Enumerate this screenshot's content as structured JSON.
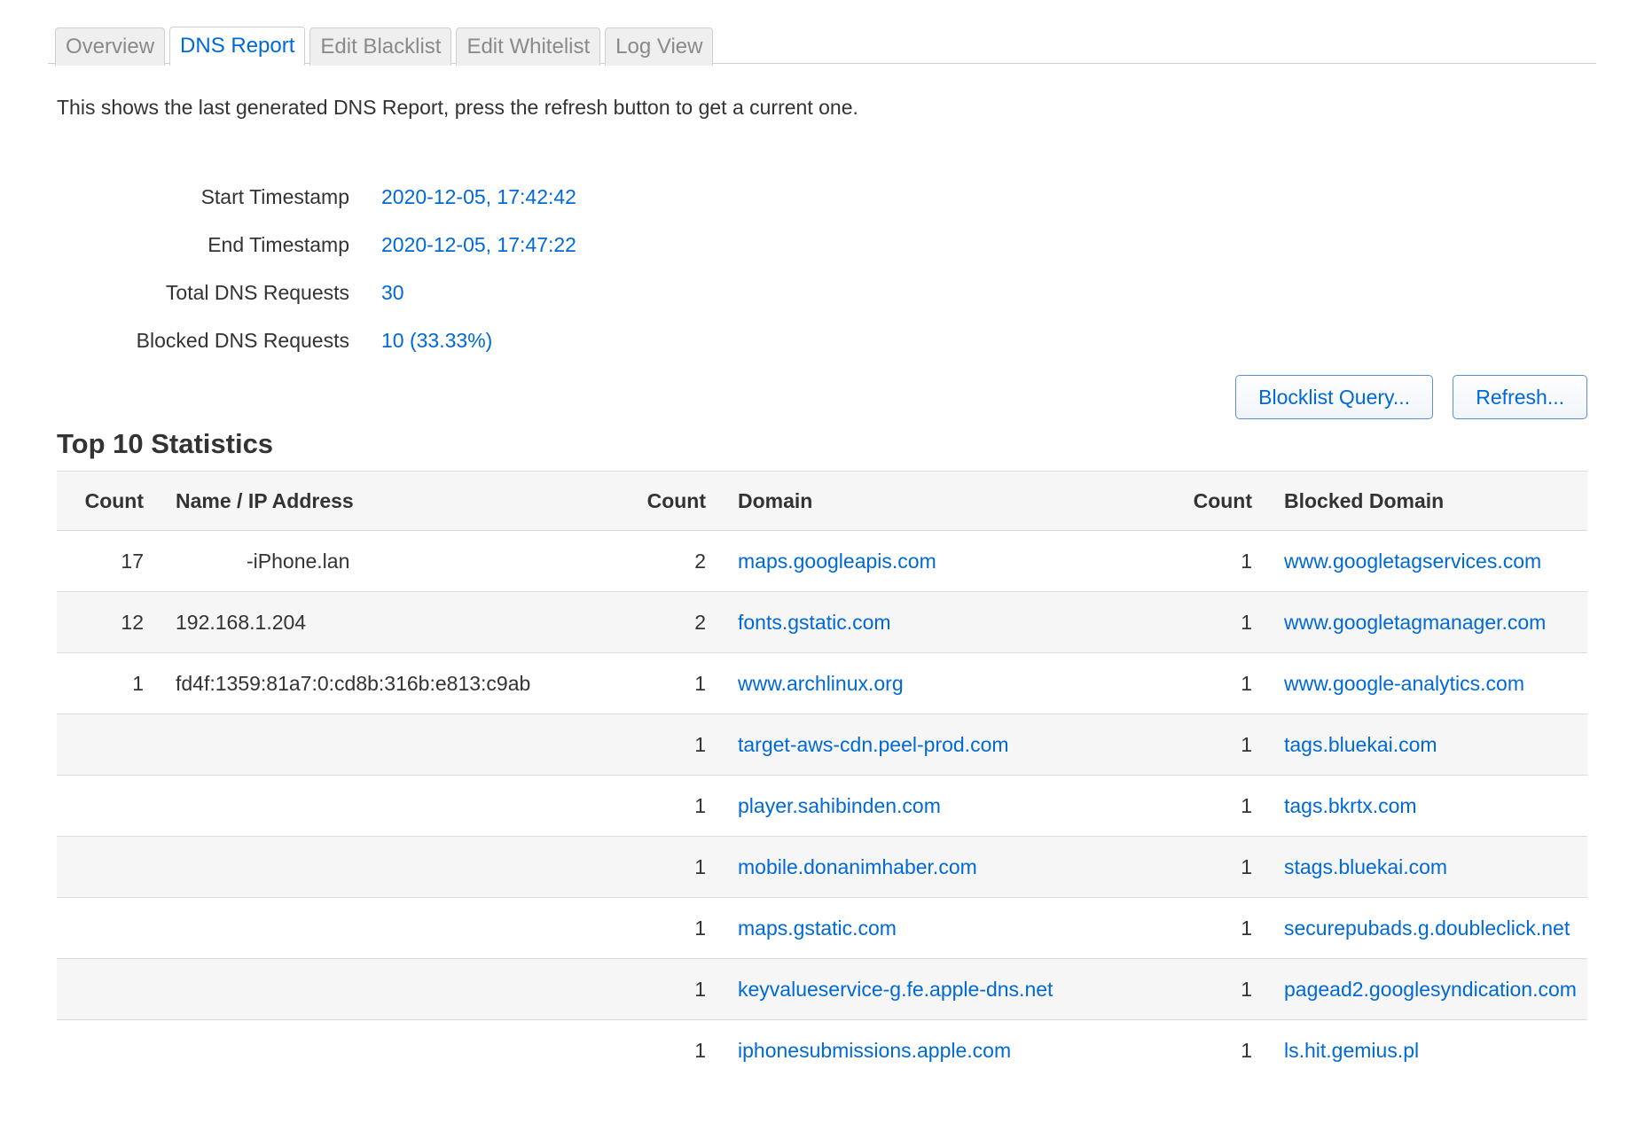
{
  "tabs": [
    {
      "label": "Overview",
      "active": false
    },
    {
      "label": "DNS Report",
      "active": true
    },
    {
      "label": "Edit Blacklist",
      "active": false
    },
    {
      "label": "Edit Whitelist",
      "active": false
    },
    {
      "label": "Log View",
      "active": false
    }
  ],
  "intro": "This shows the last generated DNS Report, press the refresh button to get a current one.",
  "summary": {
    "start_label": "Start Timestamp",
    "start_value": "2020-12-05, 17:42:42",
    "end_label": "End Timestamp",
    "end_value": "2020-12-05, 17:47:22",
    "total_label": "Total DNS Requests",
    "total_value": "30",
    "blocked_label": "Blocked DNS Requests",
    "blocked_value": "10 (33.33%)"
  },
  "buttons": {
    "query": "Blocklist Query...",
    "refresh": "Refresh..."
  },
  "colors": {
    "accent": "#0069d6",
    "text": "#333333",
    "row_alt": "#f6f6f6"
  },
  "stats": {
    "title": "Top 10 Statistics",
    "headers": [
      "Count",
      "Name / IP Address",
      "Count",
      "Domain",
      "Count",
      "Blocked Domain"
    ],
    "rows": [
      [
        "17",
        "-iPhone.lan",
        "2",
        "maps.googleapis.com",
        "1",
        "www.googletagservices.com"
      ],
      [
        "12",
        "192.168.1.204",
        "2",
        "fonts.gstatic.com",
        "1",
        "www.googletagmanager.com"
      ],
      [
        "1",
        "fd4f:1359:81a7:0:cd8b:316b:e813:c9ab",
        "1",
        "www.archlinux.org",
        "1",
        "www.google-analytics.com"
      ],
      [
        "",
        "",
        "1",
        "target-aws-cdn.peel-prod.com",
        "1",
        "tags.bluekai.com"
      ],
      [
        "",
        "",
        "1",
        "player.sahibinden.com",
        "1",
        "tags.bkrtx.com"
      ],
      [
        "",
        "",
        "1",
        "mobile.donanimhaber.com",
        "1",
        "stags.bluekai.com"
      ],
      [
        "",
        "",
        "1",
        "maps.gstatic.com",
        "1",
        "securepubads.g.doubleclick.net"
      ],
      [
        "",
        "",
        "1",
        "keyvalueservice-g.fe.apple-dns.net",
        "1",
        "pagead2.googlesyndication.com"
      ],
      [
        "",
        "",
        "1",
        "iphonesubmissions.apple.com",
        "1",
        "ls.hit.gemius.pl"
      ]
    ]
  }
}
